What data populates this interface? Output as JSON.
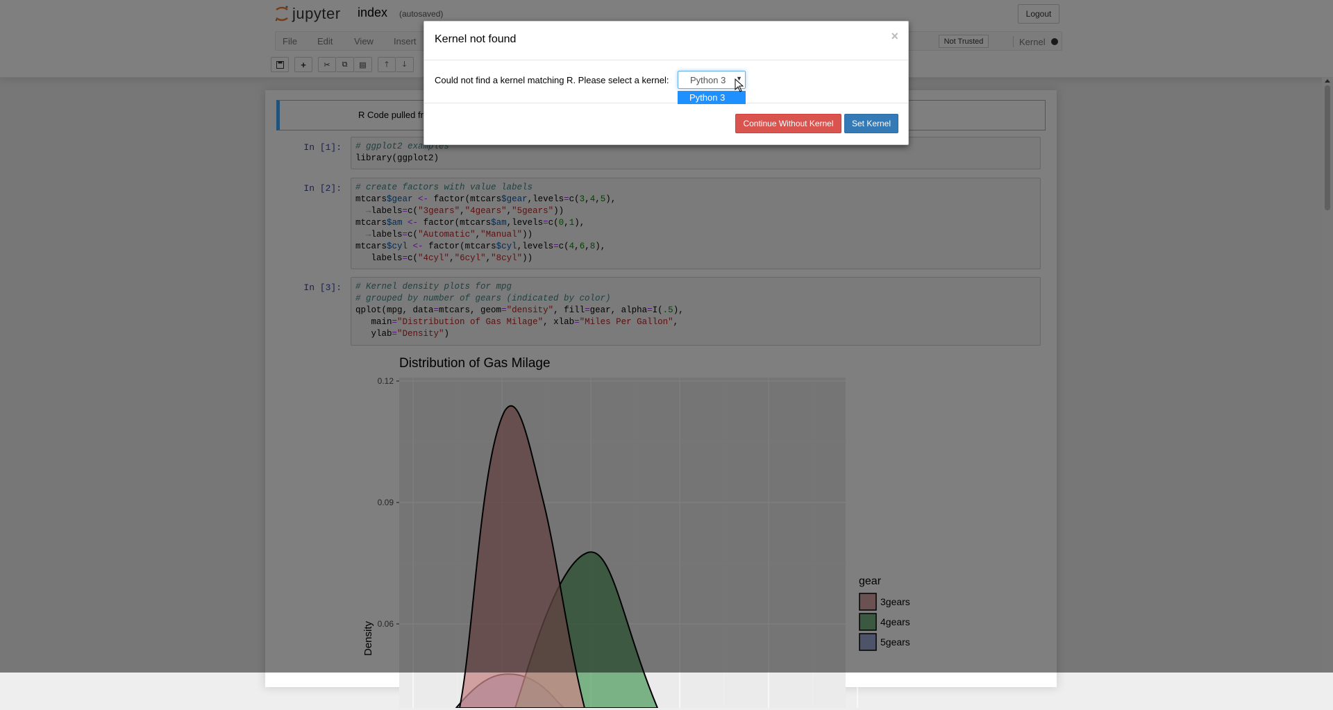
{
  "header": {
    "logo_text": "jupyter",
    "notebook_name": "index",
    "autosave_status": "(autosaved)",
    "logout_label": "Logout",
    "trust_status": "Not Trusted",
    "kernel_label": "Kernel"
  },
  "menu": {
    "items": [
      "File",
      "Edit",
      "View",
      "Insert"
    ]
  },
  "toolbar": {
    "buttons": [
      "save-icon",
      "plus-icon",
      "scissors-icon",
      "copy-icon",
      "paste-icon",
      "arrow-up-icon",
      "arrow-down-icon"
    ]
  },
  "notebook": {
    "markdown_text": "R Code pulled fr",
    "cells": [
      {
        "prompt": "In [1]:"
      },
      {
        "prompt": "In [2]:"
      },
      {
        "prompt": "In [3]:"
      }
    ]
  },
  "chart_data": {
    "type": "area",
    "title": "Distribution of Gas Milage",
    "xlabel": "",
    "ylabel": "Density",
    "yticks": [
      "0.12",
      "0.09",
      "0.06"
    ],
    "ylim": [
      0.045,
      0.125
    ],
    "legend_title": "gear",
    "legend_position": "right",
    "series": [
      {
        "name": "3gears",
        "color": "#c78586"
      },
      {
        "name": "4gears",
        "color": "#4a9a5a"
      },
      {
        "name": "5gears",
        "color": "#7a8cc4"
      }
    ],
    "grid": true,
    "background": "#ebebeb"
  },
  "modal": {
    "title": "Kernel not found",
    "close_glyph": "×",
    "message": "Could not find a kernel matching R. Please select a kernel:",
    "selected_kernel": "Python 3",
    "options": [
      "Python 3"
    ],
    "continue_label": "Continue Without Kernel",
    "set_label": "Set Kernel"
  }
}
